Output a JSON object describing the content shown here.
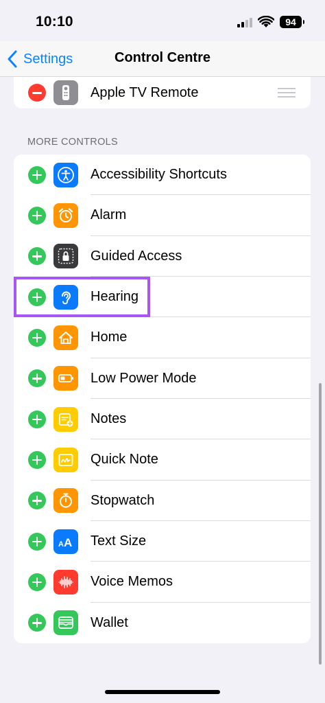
{
  "status_bar": {
    "time": "10:10",
    "battery": "94"
  },
  "nav": {
    "back_label": "Settings",
    "title": "Control Centre"
  },
  "included": {
    "items": [
      {
        "label": "Apple TV Remote",
        "icon": "tv-remote-icon",
        "color": "#8e8e93"
      }
    ]
  },
  "more_controls": {
    "header": "MORE CONTROLS",
    "items": [
      {
        "label": "Accessibility Shortcuts",
        "icon": "accessibility-icon",
        "color": "#0a7aff"
      },
      {
        "label": "Alarm",
        "icon": "alarm-clock-icon",
        "color": "#ff9500"
      },
      {
        "label": "Guided Access",
        "icon": "lock-icon",
        "color": "#3a3a3c"
      },
      {
        "label": "Hearing",
        "icon": "ear-icon",
        "color": "#0a7aff"
      },
      {
        "label": "Home",
        "icon": "home-icon",
        "color": "#ff9500"
      },
      {
        "label": "Low Power Mode",
        "icon": "battery-icon",
        "color": "#ff9500"
      },
      {
        "label": "Notes",
        "icon": "notes-icon",
        "color": "#ffcc00"
      },
      {
        "label": "Quick Note",
        "icon": "quick-note-icon",
        "color": "#ffcc00"
      },
      {
        "label": "Stopwatch",
        "icon": "stopwatch-icon",
        "color": "#ff9500"
      },
      {
        "label": "Text Size",
        "icon": "text-size-icon",
        "color": "#0a7aff"
      },
      {
        "label": "Voice Memos",
        "icon": "waveform-icon",
        "color": "#ff3b30"
      },
      {
        "label": "Wallet",
        "icon": "wallet-icon",
        "color": "#34c759"
      }
    ]
  },
  "colors": {
    "accent": "#0a84ff",
    "add": "#34c759",
    "remove": "#ff3b30",
    "highlight": "#a855f7"
  }
}
